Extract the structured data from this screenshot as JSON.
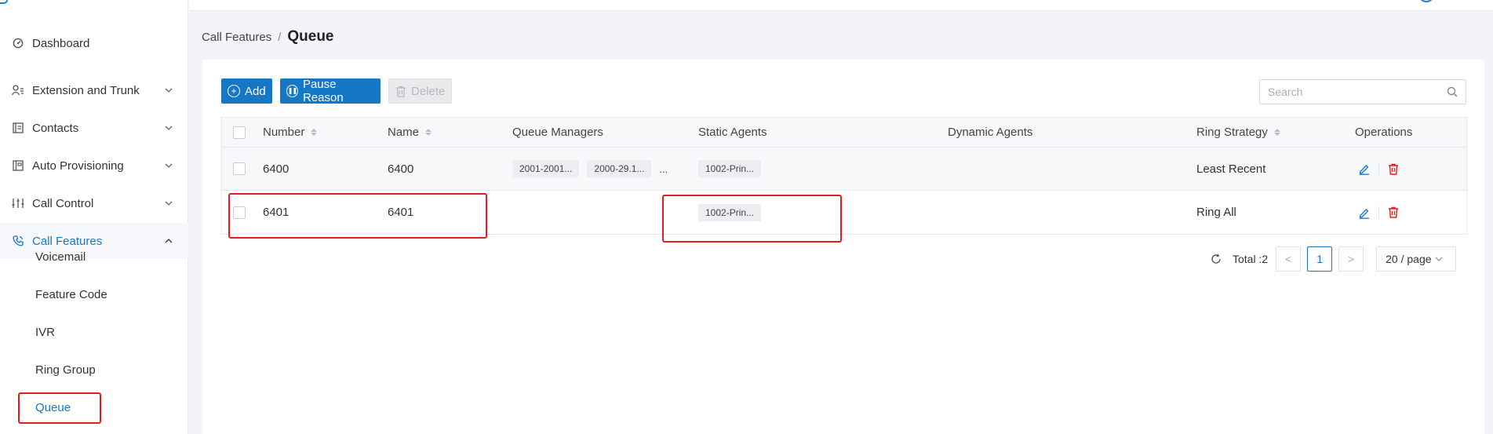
{
  "sidebar": {
    "items": [
      {
        "label": "Dashboard",
        "icon": "dashboard-icon",
        "expandable": false
      },
      {
        "label": "Extension and Trunk",
        "icon": "user-list-icon",
        "expandable": true
      },
      {
        "label": "Contacts",
        "icon": "contacts-icon",
        "expandable": true
      },
      {
        "label": "Auto Provisioning",
        "icon": "provisioning-icon",
        "expandable": true
      },
      {
        "label": "Call Control",
        "icon": "sliders-icon",
        "expandable": true
      },
      {
        "label": "Call Features",
        "icon": "phone-icon",
        "expandable": true,
        "expanded": true
      }
    ],
    "subitems": [
      "Voicemail",
      "Feature Code",
      "IVR",
      "Ring Group",
      "Queue"
    ],
    "current": "Queue"
  },
  "breadcrumb": {
    "parent": "Call Features",
    "separator": "/",
    "current": "Queue"
  },
  "toolbar": {
    "add_label": "Add",
    "pause_reason_label": "Pause Reason",
    "delete_label": "Delete",
    "search_placeholder": "Search"
  },
  "table": {
    "columns": [
      "Number",
      "Name",
      "Queue Managers",
      "Static Agents",
      "Dynamic Agents",
      "Ring Strategy",
      "Operations"
    ],
    "rows": [
      {
        "number": "6400",
        "name": "6400",
        "queue_managers": [
          "2001-2001...",
          "2000-29.1..."
        ],
        "queue_managers_more": "...",
        "static_agents": [
          "1002-Prin..."
        ],
        "dynamic_agents": "",
        "ring_strategy": "Least Recent"
      },
      {
        "number": "6401",
        "name": "6401",
        "queue_managers": [],
        "queue_managers_more": "",
        "static_agents": [
          "1002-Prin..."
        ],
        "dynamic_agents": "",
        "ring_strategy": "Ring All"
      }
    ]
  },
  "pagination": {
    "total_label": "Total :2",
    "prev": "<",
    "page": "1",
    "next": ">",
    "page_size": "20 / page"
  },
  "colors": {
    "accent": "#1677c5",
    "delete": "#e02020",
    "highlight": "#e02020"
  }
}
